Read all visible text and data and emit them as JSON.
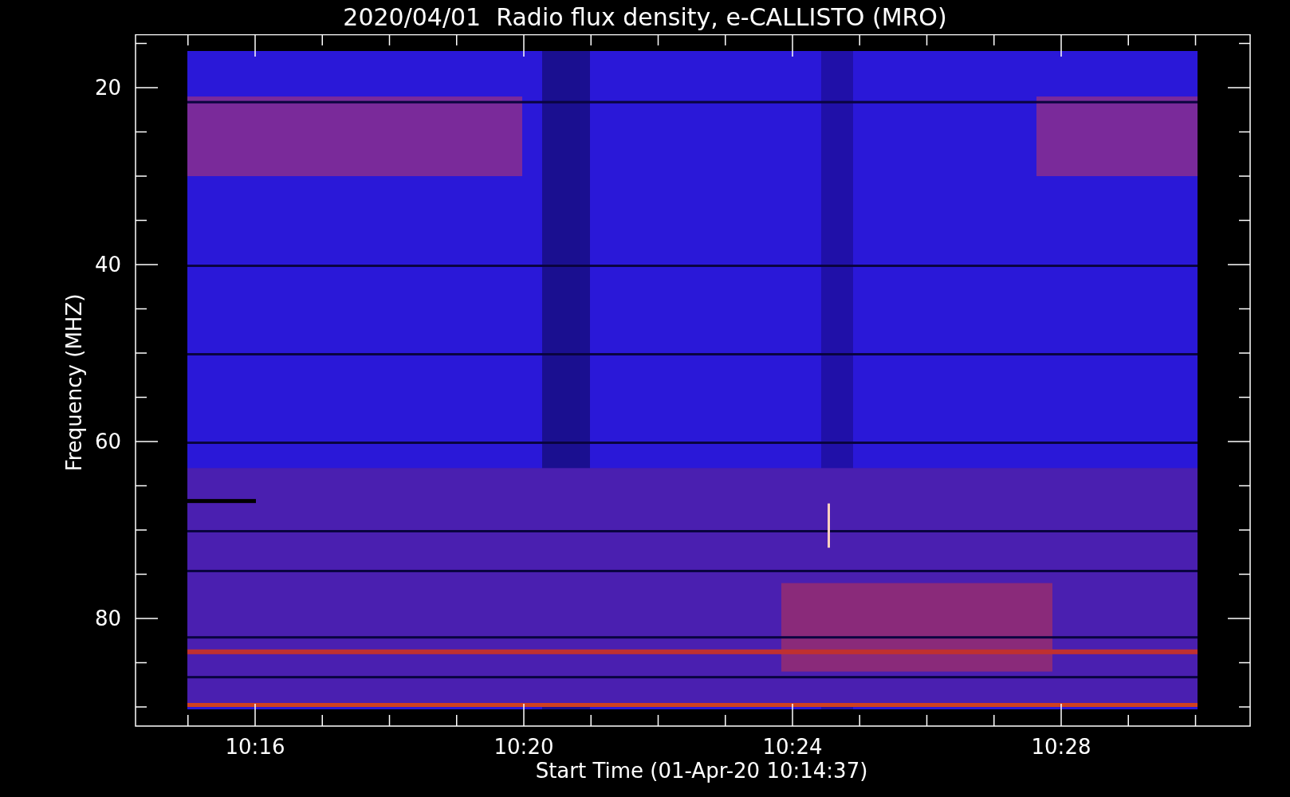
{
  "title": "2020/04/01  Radio flux density, e-CALLISTO (MRO)",
  "y_axis": {
    "label": "Frequency (MHZ)",
    "ticks": [
      "20",
      "40",
      "60",
      "80"
    ]
  },
  "x_axis": {
    "label": "Start Time (01-Apr-20 10:14:37)",
    "ticks": [
      "10:16",
      "10:20",
      "10:24",
      "10:28"
    ]
  }
}
